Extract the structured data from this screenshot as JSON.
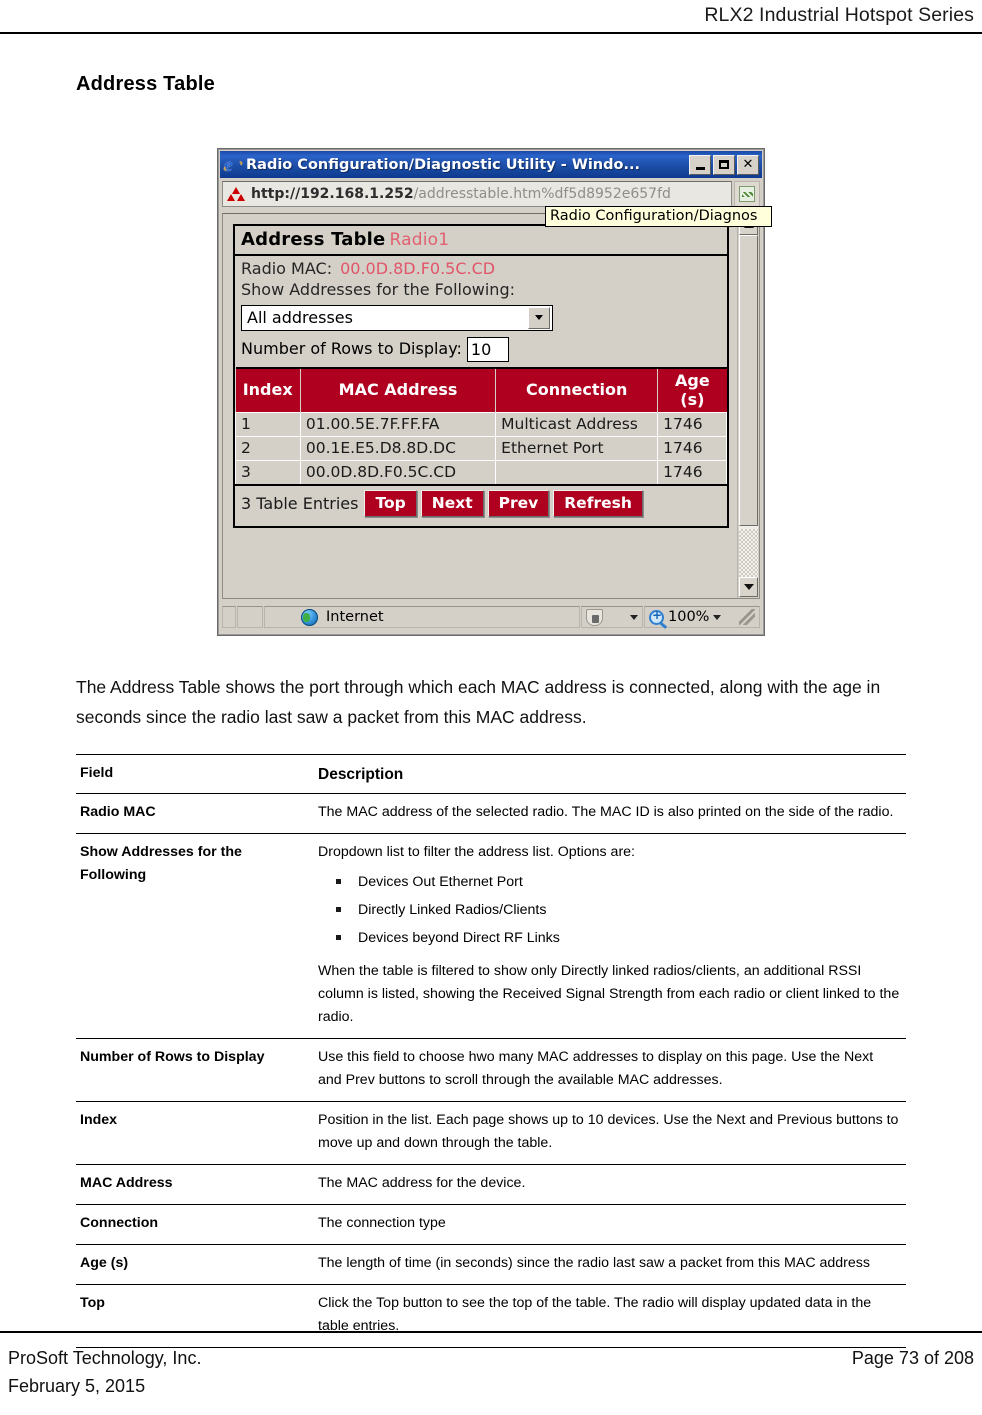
{
  "header": {
    "title": "RLX2 Industrial Hotspot Series"
  },
  "section": {
    "title": "Address Table",
    "intro": "The Address Table shows the port through which each MAC address is connected, along with the age in seconds since the radio last saw a packet from this MAC address."
  },
  "screenshot": {
    "window_title": "Radio Configuration/Diagnostic Utility - Windo...",
    "window_buttons": {
      "minimize": "_",
      "maximize": "□",
      "close": "×"
    },
    "url_strong": "http://192.168.1.252",
    "url_dim": "/addresstable.htm%df5d8952e657fd",
    "tooltip": "Radio Configuration/Diagnos",
    "app": {
      "title": "Address Table",
      "radio_name": "Radio1",
      "radio_mac_label": "Radio MAC:",
      "radio_mac_value": "00.0D.8D.F0.5C.CD",
      "show_addresses_label": "Show Addresses for the Following:",
      "filter_selected": "All addresses",
      "rows_label": "Number of Rows to Display:",
      "rows_value": "10",
      "columns": [
        "Index",
        "MAC Address",
        "Connection",
        "Age (s)"
      ],
      "rows": [
        {
          "index": "1",
          "mac": "01.00.5E.7F.FF.FA",
          "connection": "Multicast Address",
          "age": "1746"
        },
        {
          "index": "2",
          "mac": "00.1E.E5.D8.8D.DC",
          "connection": "Ethernet Port",
          "age": "1746"
        },
        {
          "index": "3",
          "mac": "00.0D.8D.F0.5C.CD",
          "connection": "",
          "age": "1746"
        }
      ],
      "entries_label": "3 Table Entries",
      "buttons": [
        "Top",
        "Next",
        "Prev",
        "Refresh"
      ]
    },
    "statusbar": {
      "zone": "Internet",
      "zoom": "100%"
    }
  },
  "desc_table": {
    "head": {
      "field": "Field",
      "description": "Description"
    },
    "rows": [
      {
        "field": "Radio MAC",
        "description": "The MAC address of the selected radio. The MAC ID is also printed on the side of the radio."
      },
      {
        "field": "Show Addresses for the Following",
        "description": "Dropdown list to filter the address list. Options are:",
        "bullets": [
          "Devices Out Ethernet Port",
          "Directly Linked Radios/Clients",
          "Devices beyond Direct RF Links"
        ],
        "description2": "When the table is filtered to show only Directly linked radios/clients, an additional RSSI column is listed, showing the Received Signal Strength from each radio or client linked to the radio."
      },
      {
        "field": "Number of Rows to Display",
        "description": "Use this field to choose hwo many MAC addresses to display on this page. Use the Next and Prev buttons to scroll through the available MAC addresses."
      },
      {
        "field": "Index",
        "description": "Position in the list. Each page shows up to 10 devices. Use the Next and Previous buttons to move up and down through the table."
      },
      {
        "field": "MAC Address",
        "description": "The MAC address for the device."
      },
      {
        "field": "Connection",
        "description": "The connection type"
      },
      {
        "field": "Age (s)",
        "description": "The length of time (in seconds) since the radio last saw a packet from this MAC address"
      },
      {
        "field": "Top",
        "description": "Click the Top button to see the top of the table. The radio will display updated data in the table entries."
      }
    ]
  },
  "footer": {
    "company": "ProSoft Technology, Inc.",
    "date": "February 5, 2015",
    "page": "Page 73 of 208"
  }
}
